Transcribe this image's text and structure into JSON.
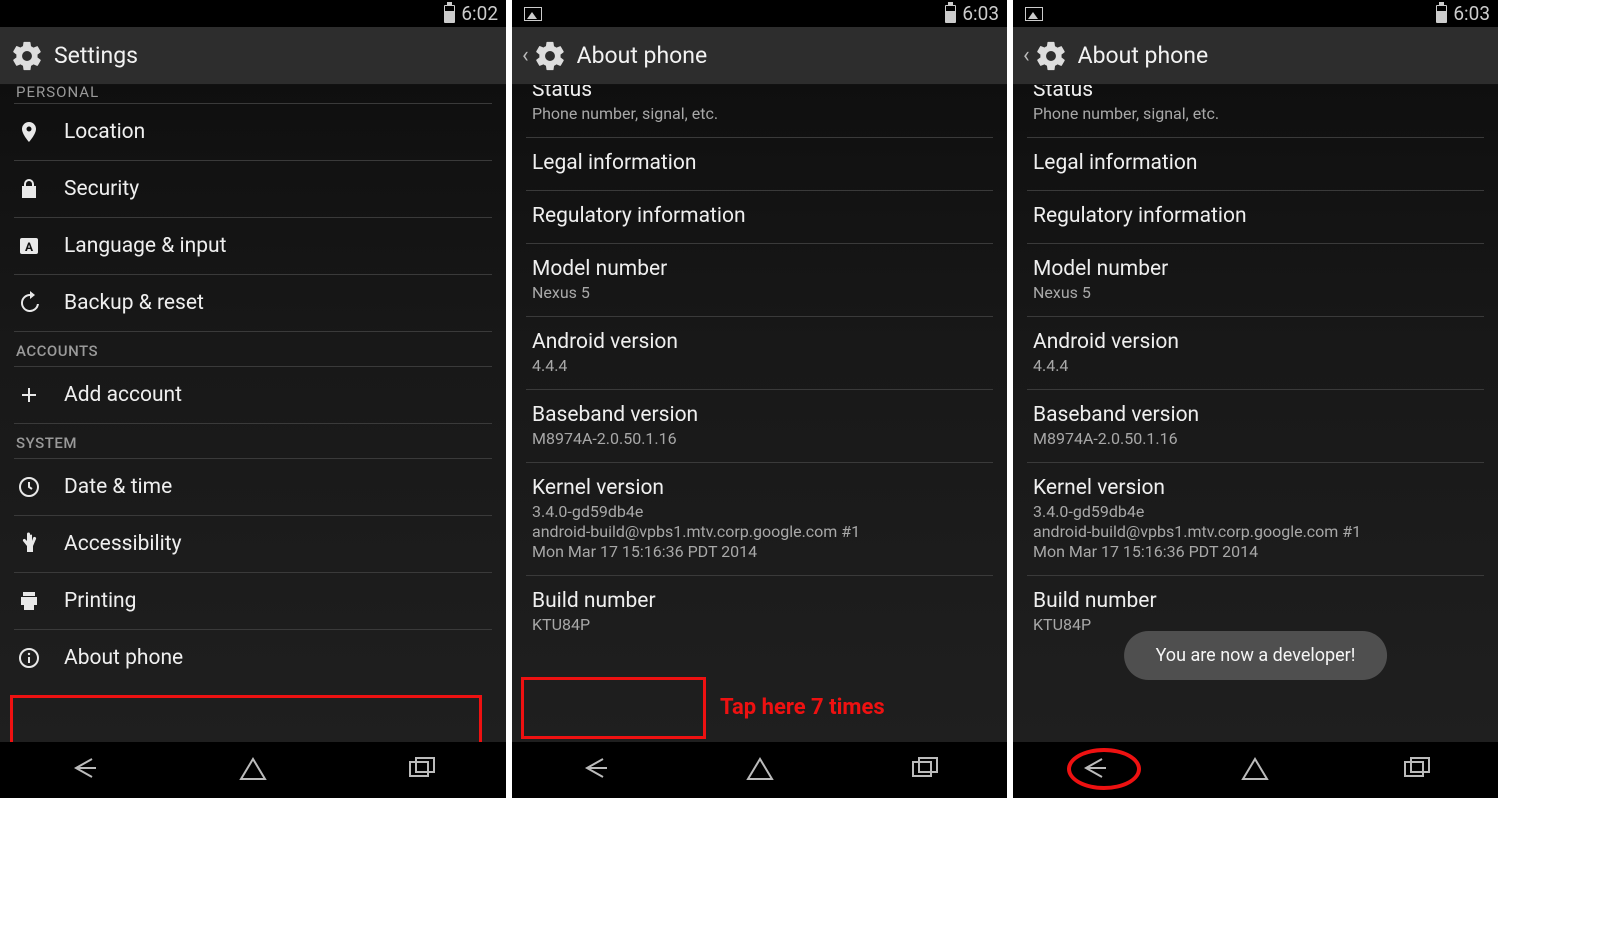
{
  "phones": [
    {
      "status": {
        "time": "6:02",
        "has_pic_icon": false
      },
      "action_bar": {
        "title": "Settings",
        "back": false
      },
      "settings": {
        "personal_header_cut": "PERSONAL",
        "items": [
          {
            "label": "Location"
          },
          {
            "label": "Security"
          },
          {
            "label": "Language & input"
          },
          {
            "label": "Backup & reset"
          }
        ],
        "accounts_header": "ACCOUNTS",
        "add_account": "Add account",
        "system_header": "SYSTEM",
        "system_items": [
          {
            "label": "Date & time"
          },
          {
            "label": "Accessibility"
          },
          {
            "label": "Printing"
          },
          {
            "label": "About phone"
          }
        ]
      }
    },
    {
      "status": {
        "time": "6:03",
        "has_pic_icon": true
      },
      "action_bar": {
        "title": "About phone",
        "back": true
      },
      "about": [
        {
          "title": "Status",
          "sub": "Phone number, signal, etc.",
          "partial": true
        },
        {
          "title": "Legal information"
        },
        {
          "title": "Regulatory information"
        },
        {
          "title": "Model number",
          "sub": "Nexus 5"
        },
        {
          "title": "Android version",
          "sub": "4.4.4"
        },
        {
          "title": "Baseband version",
          "sub": "M8974A-2.0.50.1.16"
        },
        {
          "title": "Kernel version",
          "sub": "3.4.0-gd59db4e\nandroid-build@vpbs1.mtv.corp.google.com #1\nMon Mar 17 15:16:36 PDT 2014"
        },
        {
          "title": "Build number",
          "sub": "KTU84P"
        }
      ],
      "annotation": "Tap here 7 times"
    },
    {
      "status": {
        "time": "6:03",
        "has_pic_icon": true
      },
      "action_bar": {
        "title": "About phone",
        "back": true
      },
      "about": [
        {
          "title": "Status",
          "sub": "Phone number, signal, etc.",
          "partial": true
        },
        {
          "title": "Legal information"
        },
        {
          "title": "Regulatory information"
        },
        {
          "title": "Model number",
          "sub": "Nexus 5"
        },
        {
          "title": "Android version",
          "sub": "4.4.4"
        },
        {
          "title": "Baseband version",
          "sub": "M8974A-2.0.50.1.16"
        },
        {
          "title": "Kernel version",
          "sub": "3.4.0-gd59db4e\nandroid-build@vpbs1.mtv.corp.google.com #1\nMon Mar 17 15:16:36 PDT 2014"
        },
        {
          "title": "Build number",
          "sub": "KTU84P"
        }
      ],
      "toast": "You are now a developer!"
    }
  ]
}
